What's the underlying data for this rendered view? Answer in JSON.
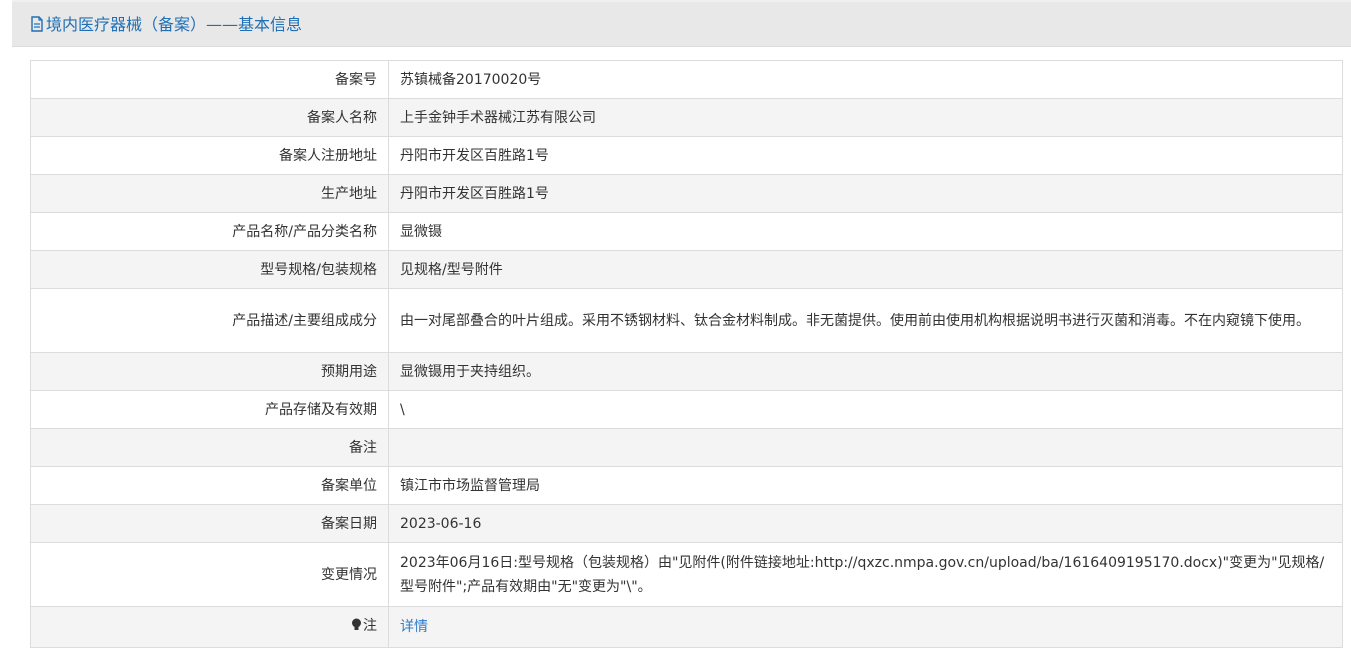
{
  "header": {
    "title": "境内医疗器械（备案）——基本信息",
    "icon": "document-icon",
    "color": "#1f6fb6"
  },
  "rows": [
    {
      "label": "备案号",
      "value": "苏镇械备20170020号"
    },
    {
      "label": "备案人名称",
      "value": "上手金钟手术器械江苏有限公司"
    },
    {
      "label": "备案人注册地址",
      "value": "丹阳市开发区百胜路1号"
    },
    {
      "label": "生产地址",
      "value": "丹阳市开发区百胜路1号"
    },
    {
      "label": "产品名称/产品分类名称",
      "value": "显微镊"
    },
    {
      "label": "型号规格/包装规格",
      "value": "见规格/型号附件"
    },
    {
      "label": "产品描述/主要组成成分",
      "value": "由一对尾部叠合的叶片组成。采用不锈钢材料、钛合金材料制成。非无菌提供。使用前由使用机构根据说明书进行灭菌和消毒。不在内窥镜下使用。"
    },
    {
      "label": "预期用途",
      "value": "显微镊用于夹持组织。"
    },
    {
      "label": "产品存储及有效期",
      "value": "\\"
    },
    {
      "label": "备注",
      "value": ""
    },
    {
      "label": "备案单位",
      "value": "镇江市市场监督管理局"
    },
    {
      "label": "备案日期",
      "value": "2023-06-16"
    },
    {
      "label": "变更情况",
      "value": "2023年06月16日:型号规格（包装规格）由\"见附件(附件链接地址:http://qxzc.nmpa.gov.cn/upload/ba/1616409195170.docx)\"变更为\"见规格/型号附件\";产品有效期由\"无\"变更为\"\\\"。"
    }
  ],
  "note": {
    "label": "注",
    "icon": "lightbulb-icon",
    "link_text": "详情",
    "link_color": "#2b7ccd"
  }
}
